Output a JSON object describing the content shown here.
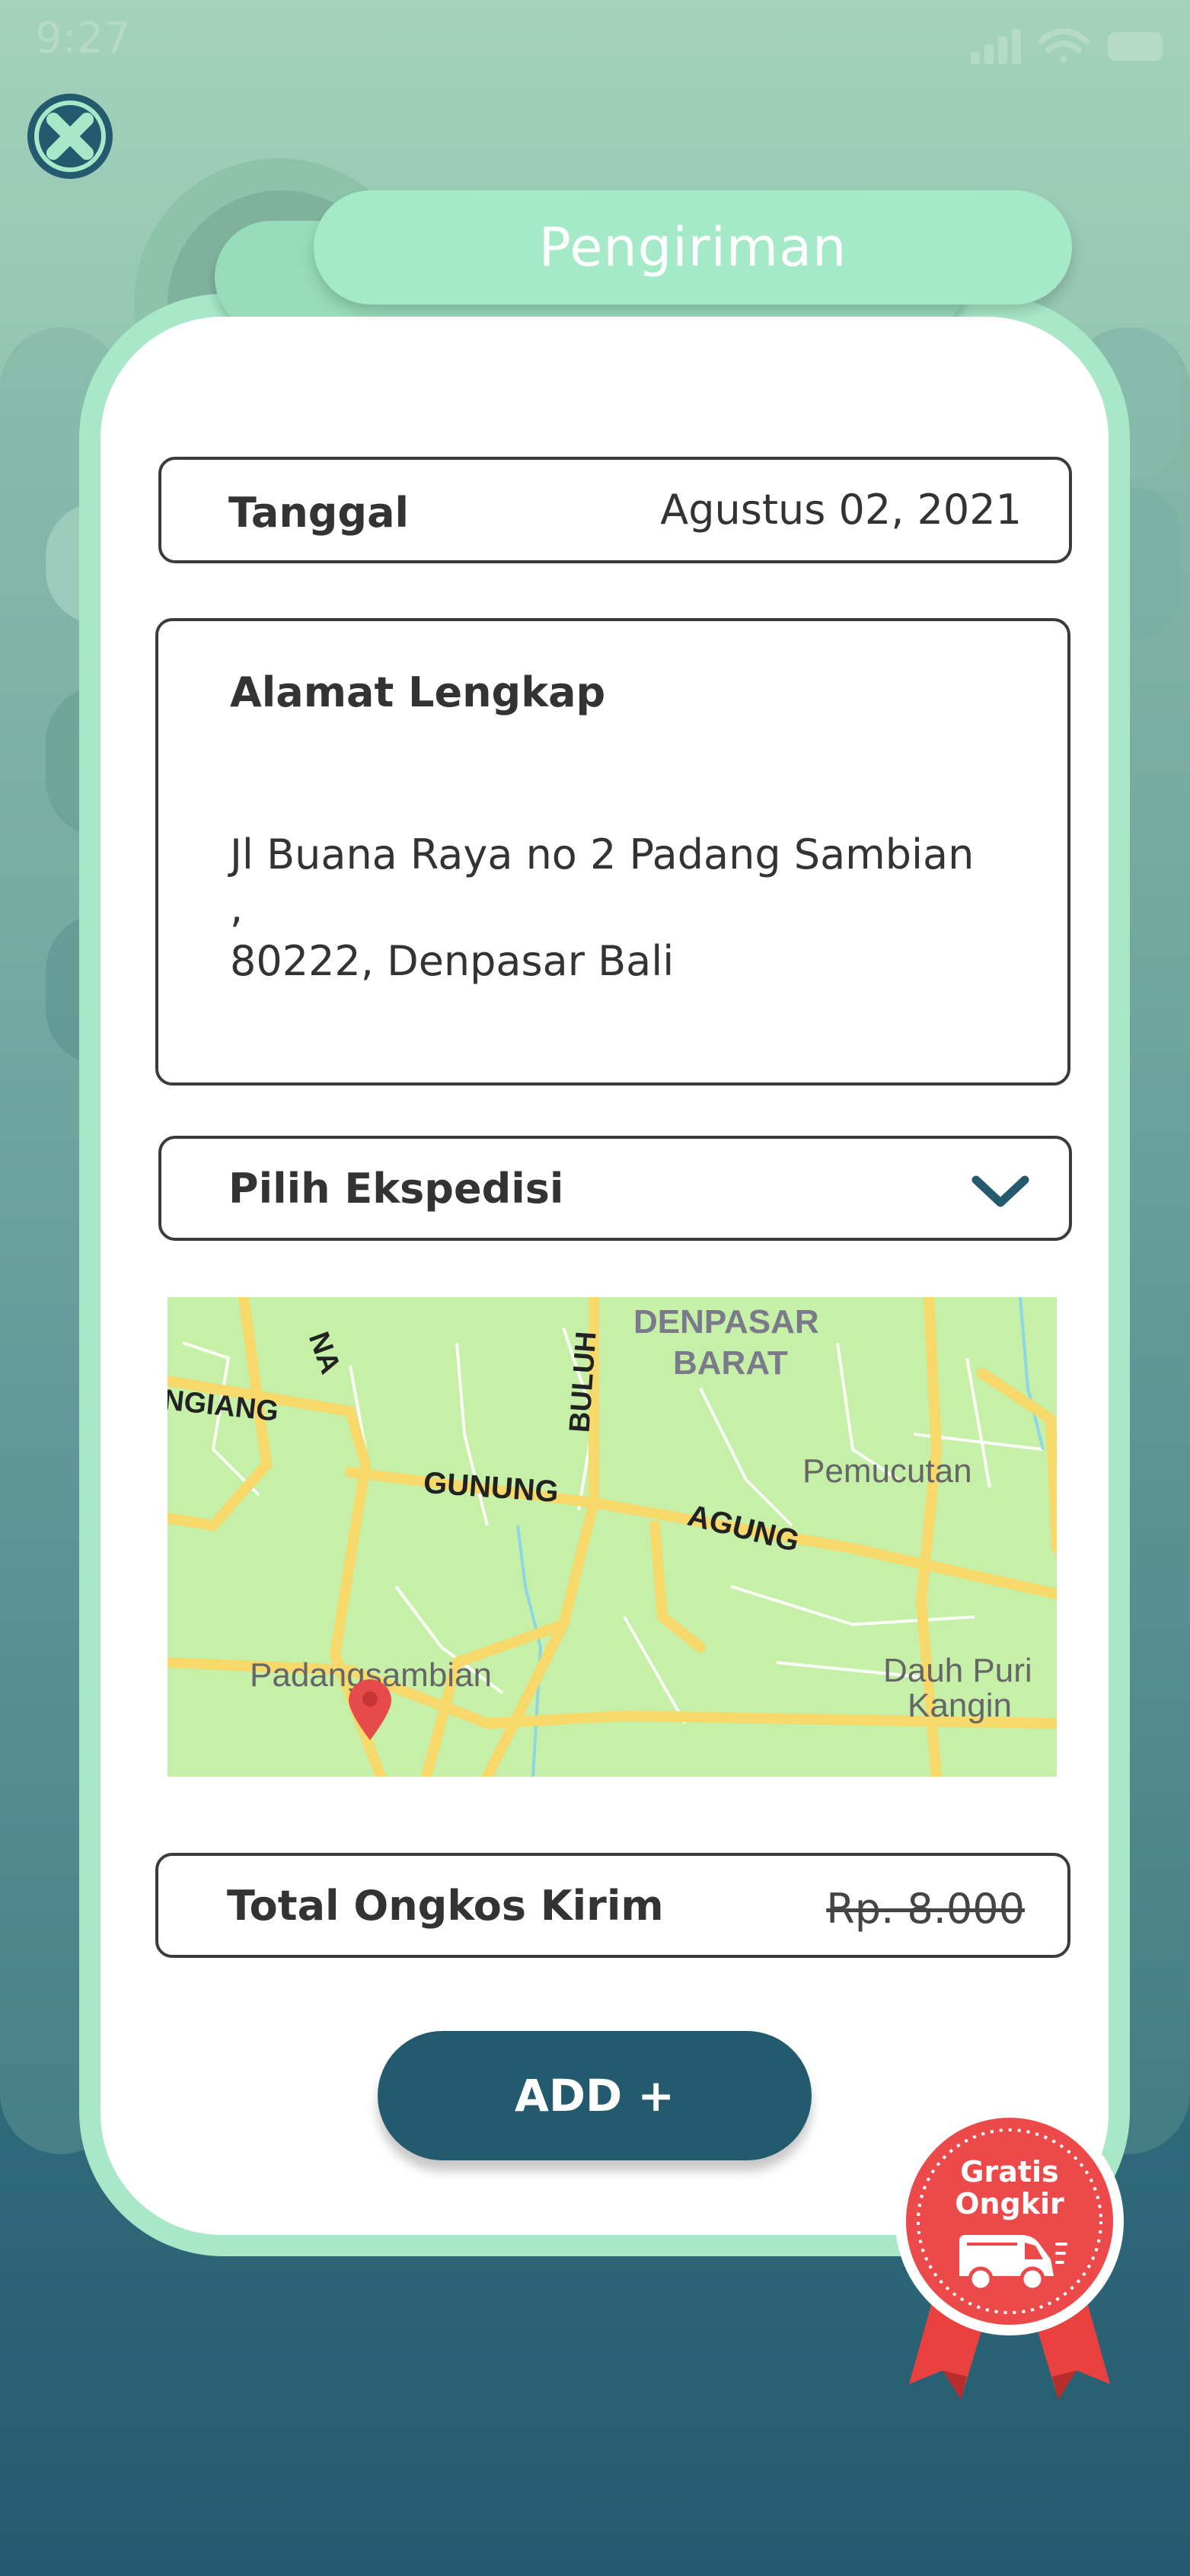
{
  "status_bar": {
    "time": "9:27"
  },
  "header": {
    "title": "Pengiriman"
  },
  "form": {
    "date": {
      "label": "Tanggal",
      "value": "Agustus 02, 2021"
    },
    "address": {
      "label": "Alamat Lengkap",
      "line1": "Jl Buana Raya no 2 Padang Sambian ,",
      "line2": "80222, Denpasar Bali"
    },
    "courier": {
      "placeholder": "Pilih Ekspedisi"
    },
    "map": {
      "labels": {
        "district": "DENPASAR",
        "district2": "BARAT",
        "area1": "Pemucutan",
        "area2": "Dauh Puri",
        "area2b": "Kangin",
        "area3": "Padangsambian",
        "road1": "GUNUNG",
        "road2": "AGUNG",
        "road3": "BULUH",
        "road4": "NGIANG",
        "road5": "NA"
      }
    },
    "shipping_total": {
      "label": "Total Ongkos Kirim",
      "price": "Rp. 8.000"
    }
  },
  "actions": {
    "add_label": "ADD +"
  },
  "badge": {
    "line1": "Gratis",
    "line2": "Ongkir"
  },
  "colors": {
    "mint": "#a5eac8",
    "navy": "#245a6d",
    "badge_red": "#ec4a4a",
    "map_bg": "#c6f0a8",
    "road": "#f7d96b"
  },
  "icons": [
    "close-icon",
    "signal-icon",
    "wifi-icon",
    "battery-icon",
    "chevron-down-icon",
    "map-pin-icon",
    "delivery-truck-icon"
  ]
}
